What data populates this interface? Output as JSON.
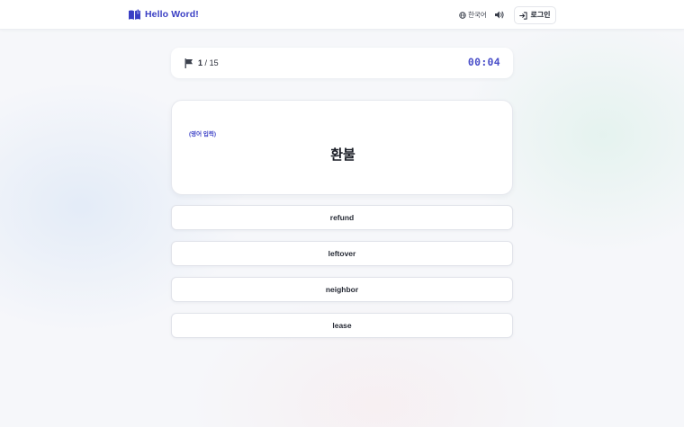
{
  "header": {
    "brand": "Hello Word!",
    "brand_icon": "book-icon",
    "language_label": "한국어",
    "language_icon": "globe-icon",
    "sound_icon": "speaker-icon",
    "login_label": "로그인",
    "login_icon": "login-icon",
    "accent_color": "#3a3fc4"
  },
  "quiz": {
    "progress_current": "1",
    "progress_total": "15",
    "progress_separator": "/",
    "timer": "00:04",
    "hint": "(영어 입력)",
    "word": "환불",
    "options": [
      "refund",
      "leftover",
      "neighbor",
      "lease"
    ]
  }
}
